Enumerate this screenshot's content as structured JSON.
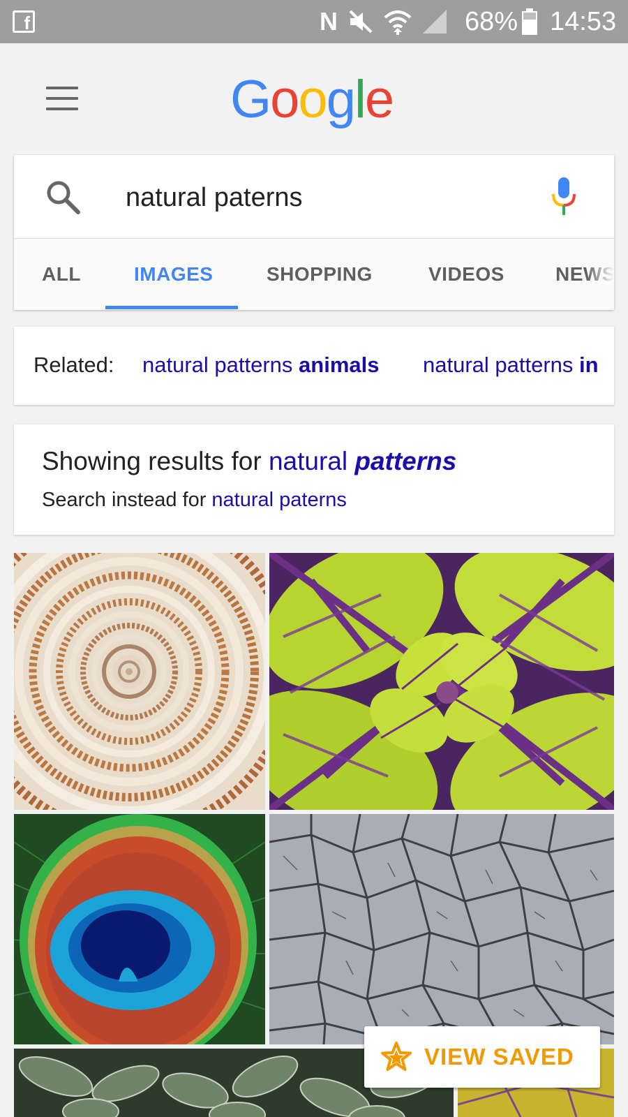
{
  "status_bar": {
    "battery": "68%",
    "time": "14:53",
    "facebook_glyph": "f",
    "nfc_glyph": "N",
    "icons": [
      "facebook-icon",
      "nfc-icon",
      "mute-icon",
      "wifi-icon",
      "signal-icon",
      "battery-icon"
    ]
  },
  "header": {
    "logo": [
      "G",
      "o",
      "o",
      "g",
      "l",
      "e"
    ],
    "logo_colors": [
      "#4285f4",
      "#ea4335",
      "#fbbc05",
      "#4285f4",
      "#34a853",
      "#ea4335"
    ]
  },
  "search": {
    "query": "natural paterns"
  },
  "tabs": [
    {
      "label": "ALL",
      "active": false
    },
    {
      "label": "IMAGES",
      "active": true
    },
    {
      "label": "SHOPPING",
      "active": false
    },
    {
      "label": "VIDEOS",
      "active": false
    },
    {
      "label": "NEWS",
      "active": false
    }
  ],
  "related": {
    "label": "Related:",
    "chips": [
      {
        "plain": "natural patterns ",
        "bold": "animals"
      },
      {
        "plain": "natural patterns ",
        "bold": "in"
      }
    ]
  },
  "spelling": {
    "showing_prefix": "Showing results for ",
    "corrected_plain": "natural ",
    "corrected_bold": "patterns",
    "instead_prefix": "Search instead for ",
    "original_query": "natural paterns"
  },
  "images": [
    {
      "subject": "spiral-shell"
    },
    {
      "subject": "coleus-leaves"
    },
    {
      "subject": "peacock-feather"
    },
    {
      "subject": "cracked-earth"
    },
    {
      "subject": "succulent"
    },
    {
      "subject": "leaf-veins"
    }
  ],
  "fab": {
    "label": "VIEW SAVED",
    "icon": "star-icon",
    "accent": "#f29900"
  },
  "colors": {
    "accent_blue": "#4285f4",
    "link": "#1a0dab",
    "status_bar": "#9e9e9e"
  }
}
